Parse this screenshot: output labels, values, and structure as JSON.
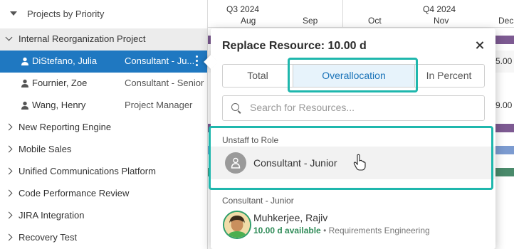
{
  "tree": {
    "header": "Projects by Priority",
    "group": "Internal Reorganization Project",
    "members": [
      {
        "name": "DiStefano, Julia",
        "role": "Consultant - Ju..."
      },
      {
        "name": "Fournier, Zoe",
        "role": "Consultant - Senior"
      },
      {
        "name": "Wang, Henry",
        "role": "Project Manager"
      }
    ],
    "projects": [
      "New Reporting Engine",
      "Mobile Sales",
      "Unified Communications Platform",
      "Code Performance Review",
      "JIRA Integration",
      "Recovery Test"
    ]
  },
  "timeline": {
    "q3": "Q3 2024",
    "q4": "Q4 2024",
    "months": [
      "Aug",
      "Sep",
      "Oct",
      "Nov",
      "Dec"
    ],
    "cell_values": [
      "5.00",
      "9.00"
    ]
  },
  "popup": {
    "title": "Replace Resource: 10.00 d",
    "tabs": [
      "Total",
      "Overallocation",
      "In Percent"
    ],
    "active_tab": "Overallocation",
    "search_placeholder": "Search for Resources...",
    "section_unstaff": "Unstaff to Role",
    "unstaff_role": "Consultant - Junior",
    "section_role": "Consultant - Junior",
    "resource": {
      "name": "Muhkerjee, Rajiv",
      "availability": "10.00 d available",
      "separator": " • ",
      "department": "Requirements Engineering"
    }
  },
  "colors": {
    "accent": "#1f78c1",
    "highlight": "#1fb7ad",
    "available": "#2e8b57"
  }
}
